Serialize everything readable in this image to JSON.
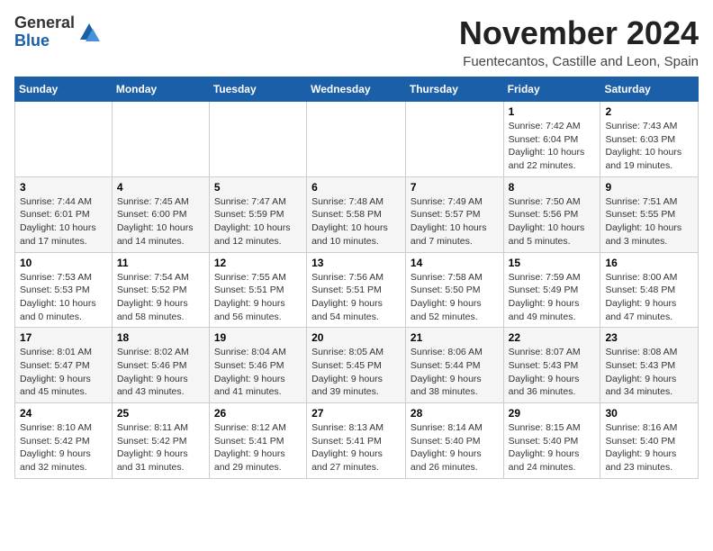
{
  "logo": {
    "general": "General",
    "blue": "Blue"
  },
  "header": {
    "month": "November 2024",
    "location": "Fuentecantos, Castille and Leon, Spain"
  },
  "days_of_week": [
    "Sunday",
    "Monday",
    "Tuesday",
    "Wednesday",
    "Thursday",
    "Friday",
    "Saturday"
  ],
  "weeks": [
    [
      {
        "day": "",
        "info": ""
      },
      {
        "day": "",
        "info": ""
      },
      {
        "day": "",
        "info": ""
      },
      {
        "day": "",
        "info": ""
      },
      {
        "day": "",
        "info": ""
      },
      {
        "day": "1",
        "info": "Sunrise: 7:42 AM\nSunset: 6:04 PM\nDaylight: 10 hours and 22 minutes."
      },
      {
        "day": "2",
        "info": "Sunrise: 7:43 AM\nSunset: 6:03 PM\nDaylight: 10 hours and 19 minutes."
      }
    ],
    [
      {
        "day": "3",
        "info": "Sunrise: 7:44 AM\nSunset: 6:01 PM\nDaylight: 10 hours and 17 minutes."
      },
      {
        "day": "4",
        "info": "Sunrise: 7:45 AM\nSunset: 6:00 PM\nDaylight: 10 hours and 14 minutes."
      },
      {
        "day": "5",
        "info": "Sunrise: 7:47 AM\nSunset: 5:59 PM\nDaylight: 10 hours and 12 minutes."
      },
      {
        "day": "6",
        "info": "Sunrise: 7:48 AM\nSunset: 5:58 PM\nDaylight: 10 hours and 10 minutes."
      },
      {
        "day": "7",
        "info": "Sunrise: 7:49 AM\nSunset: 5:57 PM\nDaylight: 10 hours and 7 minutes."
      },
      {
        "day": "8",
        "info": "Sunrise: 7:50 AM\nSunset: 5:56 PM\nDaylight: 10 hours and 5 minutes."
      },
      {
        "day": "9",
        "info": "Sunrise: 7:51 AM\nSunset: 5:55 PM\nDaylight: 10 hours and 3 minutes."
      }
    ],
    [
      {
        "day": "10",
        "info": "Sunrise: 7:53 AM\nSunset: 5:53 PM\nDaylight: 10 hours and 0 minutes."
      },
      {
        "day": "11",
        "info": "Sunrise: 7:54 AM\nSunset: 5:52 PM\nDaylight: 9 hours and 58 minutes."
      },
      {
        "day": "12",
        "info": "Sunrise: 7:55 AM\nSunset: 5:51 PM\nDaylight: 9 hours and 56 minutes."
      },
      {
        "day": "13",
        "info": "Sunrise: 7:56 AM\nSunset: 5:51 PM\nDaylight: 9 hours and 54 minutes."
      },
      {
        "day": "14",
        "info": "Sunrise: 7:58 AM\nSunset: 5:50 PM\nDaylight: 9 hours and 52 minutes."
      },
      {
        "day": "15",
        "info": "Sunrise: 7:59 AM\nSunset: 5:49 PM\nDaylight: 9 hours and 49 minutes."
      },
      {
        "day": "16",
        "info": "Sunrise: 8:00 AM\nSunset: 5:48 PM\nDaylight: 9 hours and 47 minutes."
      }
    ],
    [
      {
        "day": "17",
        "info": "Sunrise: 8:01 AM\nSunset: 5:47 PM\nDaylight: 9 hours and 45 minutes."
      },
      {
        "day": "18",
        "info": "Sunrise: 8:02 AM\nSunset: 5:46 PM\nDaylight: 9 hours and 43 minutes."
      },
      {
        "day": "19",
        "info": "Sunrise: 8:04 AM\nSunset: 5:46 PM\nDaylight: 9 hours and 41 minutes."
      },
      {
        "day": "20",
        "info": "Sunrise: 8:05 AM\nSunset: 5:45 PM\nDaylight: 9 hours and 39 minutes."
      },
      {
        "day": "21",
        "info": "Sunrise: 8:06 AM\nSunset: 5:44 PM\nDaylight: 9 hours and 38 minutes."
      },
      {
        "day": "22",
        "info": "Sunrise: 8:07 AM\nSunset: 5:43 PM\nDaylight: 9 hours and 36 minutes."
      },
      {
        "day": "23",
        "info": "Sunrise: 8:08 AM\nSunset: 5:43 PM\nDaylight: 9 hours and 34 minutes."
      }
    ],
    [
      {
        "day": "24",
        "info": "Sunrise: 8:10 AM\nSunset: 5:42 PM\nDaylight: 9 hours and 32 minutes."
      },
      {
        "day": "25",
        "info": "Sunrise: 8:11 AM\nSunset: 5:42 PM\nDaylight: 9 hours and 31 minutes."
      },
      {
        "day": "26",
        "info": "Sunrise: 8:12 AM\nSunset: 5:41 PM\nDaylight: 9 hours and 29 minutes."
      },
      {
        "day": "27",
        "info": "Sunrise: 8:13 AM\nSunset: 5:41 PM\nDaylight: 9 hours and 27 minutes."
      },
      {
        "day": "28",
        "info": "Sunrise: 8:14 AM\nSunset: 5:40 PM\nDaylight: 9 hours and 26 minutes."
      },
      {
        "day": "29",
        "info": "Sunrise: 8:15 AM\nSunset: 5:40 PM\nDaylight: 9 hours and 24 minutes."
      },
      {
        "day": "30",
        "info": "Sunrise: 8:16 AM\nSunset: 5:40 PM\nDaylight: 9 hours and 23 minutes."
      }
    ]
  ]
}
